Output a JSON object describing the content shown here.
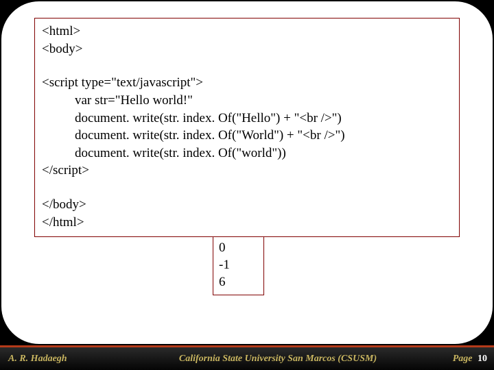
{
  "code": {
    "l1": "<html>",
    "l2": "<body>",
    "l3": "<script type=\"text/javascript\">",
    "l4": "var str=\"Hello world!\"",
    "l5": "document. write(str. index. Of(\"Hello\") + \"<br />\")",
    "l6": "document. write(str. index. Of(\"World\") + \"<br />\")",
    "l7": "document. write(str. index. Of(\"world\"))",
    "l8": "</script>",
    "l9": "</body>",
    "l10": "</html>"
  },
  "output": {
    "o1": "0",
    "o2": "-1",
    "o3": "6"
  },
  "footer": {
    "author": "A. R. Hadaegh",
    "university": "California State University San Marcos (CSUSM)",
    "page_label": "Page",
    "page_num": "10"
  }
}
